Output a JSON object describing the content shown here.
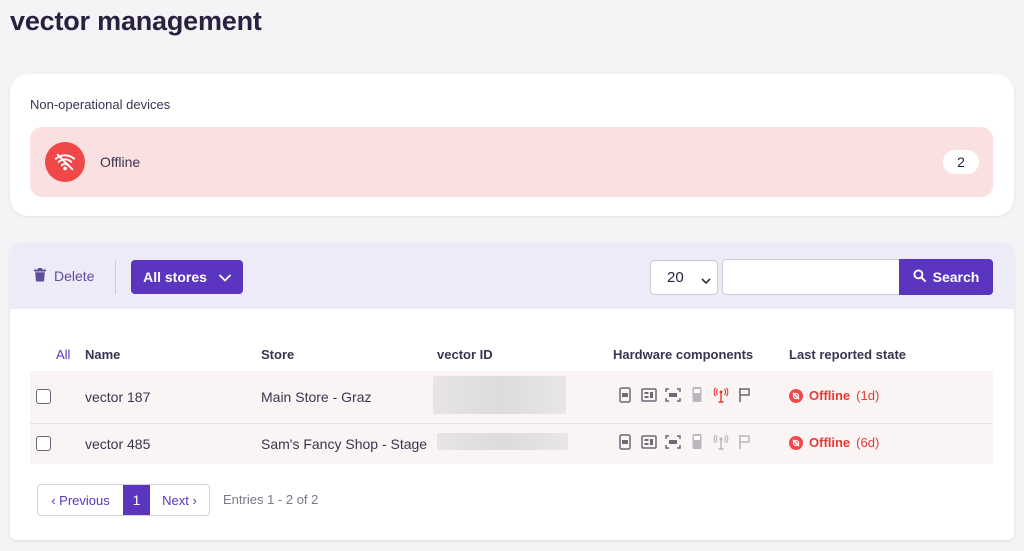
{
  "page": {
    "title": "vector management"
  },
  "non_operational": {
    "title": "Non-operational devices",
    "status_label": "Offline",
    "count": "2",
    "accent_color": "#f04848",
    "background_color": "#fbe0e1"
  },
  "toolbar": {
    "delete_label": "Delete",
    "stores_label": "All stores",
    "page_size": "20",
    "search_value": "",
    "search_label": "Search"
  },
  "table": {
    "select_all_label": "All",
    "columns": [
      "Name",
      "Store",
      "vector ID",
      "Hardware components",
      "Last reported state"
    ],
    "rows": [
      {
        "name": "vector 187",
        "store": "Main Store - Graz",
        "vector_id": "",
        "hardware_icons": [
          "card-reader-icon",
          "receipt-printer-icon",
          "scanner-icon",
          "terminal-icon",
          "antenna-icon",
          "flag-icon"
        ],
        "state": "Offline",
        "age": "(1d)"
      },
      {
        "name": "vector 485",
        "store": "Sam's Fancy Shop - Stage",
        "vector_id": "",
        "hardware_icons": [
          "card-reader-icon",
          "receipt-printer-icon",
          "scanner-icon",
          "terminal-icon",
          "antenna-icon",
          "flag-icon"
        ],
        "state": "Offline",
        "age": "(6d)"
      }
    ]
  },
  "pagination": {
    "previous_label": "‹ Previous",
    "current_page": "1",
    "next_label": "Next ›",
    "entries_text": "Entries 1 - 2 of  2"
  },
  "colors": {
    "primary": "#5b34c0",
    "offline": "#e53935",
    "toolbar_bg": "#eeebf8"
  }
}
